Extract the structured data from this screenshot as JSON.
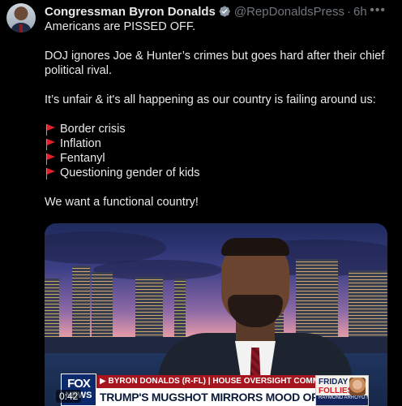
{
  "author": {
    "display_name": "Congressman Byron Donalds",
    "handle": "@RepDonaldsPress",
    "separator": "·",
    "time": "6h",
    "verified": true,
    "verified_color": "#8b98a5"
  },
  "more_label": "•••",
  "tweet": {
    "line1": "Americans are PISSED OFF.",
    "line2": "DOJ ignores Joe & Hunter’s crimes but goes hard after their chief political rival.",
    "line3": "It’s unfair & it's all happening as our country is failing around us:",
    "list": [
      "Border crisis",
      "Inflation",
      "Fentanyl",
      "Questioning gender of kids"
    ],
    "list_marker_icon": "red-flag-icon",
    "line4": "We want a functional country!"
  },
  "video": {
    "timestamp": "0:42",
    "network_logo_top": "FOX",
    "network_logo_bottom": "NEWS",
    "lower_third_top": "▶ BYRON DONALDS (R-FL) | HOUSE OVERSIGHT COMMITTEE MEMBER",
    "lower_third_main": "TRUMP'S MUGSHOT MIRRORS MOOD OF THE NATION",
    "promo_line1": "FRIDAY",
    "promo_line2": "FOLLIES",
    "promo_line3": "RAYMOND ARROYO MOMENTS AWAY"
  }
}
